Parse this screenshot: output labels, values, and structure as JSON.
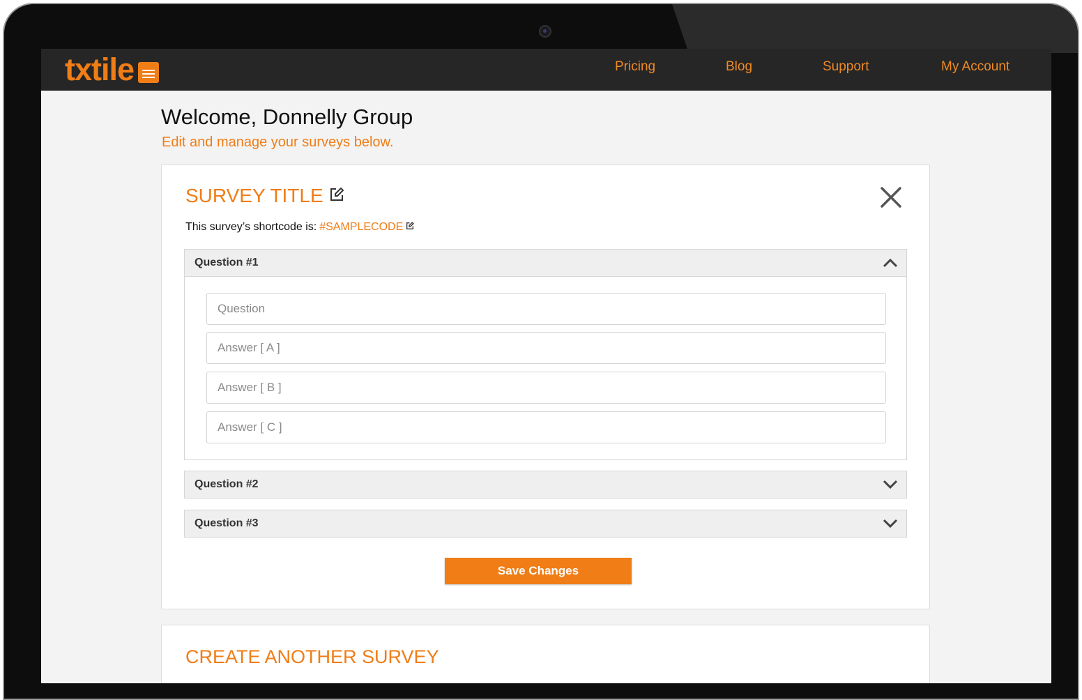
{
  "brand": {
    "name": "txtile",
    "icon": "message-icon",
    "accent": "#f07d16"
  },
  "nav": {
    "items": [
      "Pricing",
      "Blog",
      "Support",
      "My Account"
    ]
  },
  "header": {
    "welcome": "Welcome, Donnelly Group",
    "subtitle": "Edit and manage your surveys below."
  },
  "survey": {
    "title": "SURVEY TITLE",
    "shortcode_label": "This survey’s shortcode is:",
    "shortcode": "#SAMPLECODE",
    "questions": [
      {
        "label": "Question #1",
        "expanded": true,
        "fields": {
          "question_placeholder": "Question",
          "answer_a_placeholder": "Answer [ A ]",
          "answer_b_placeholder": "Answer [ B ]",
          "answer_c_placeholder": "Answer [ C ]"
        }
      },
      {
        "label": "Question #2",
        "expanded": false
      },
      {
        "label": "Question #3",
        "expanded": false
      }
    ],
    "save_label": "Save Changes"
  },
  "create": {
    "title": "CREATE ANOTHER SURVEY"
  },
  "icons": {
    "edit": "edit-icon",
    "close": "close-icon",
    "expanded": "chevron-up-icon",
    "collapsed": "chevron-down-icon"
  }
}
